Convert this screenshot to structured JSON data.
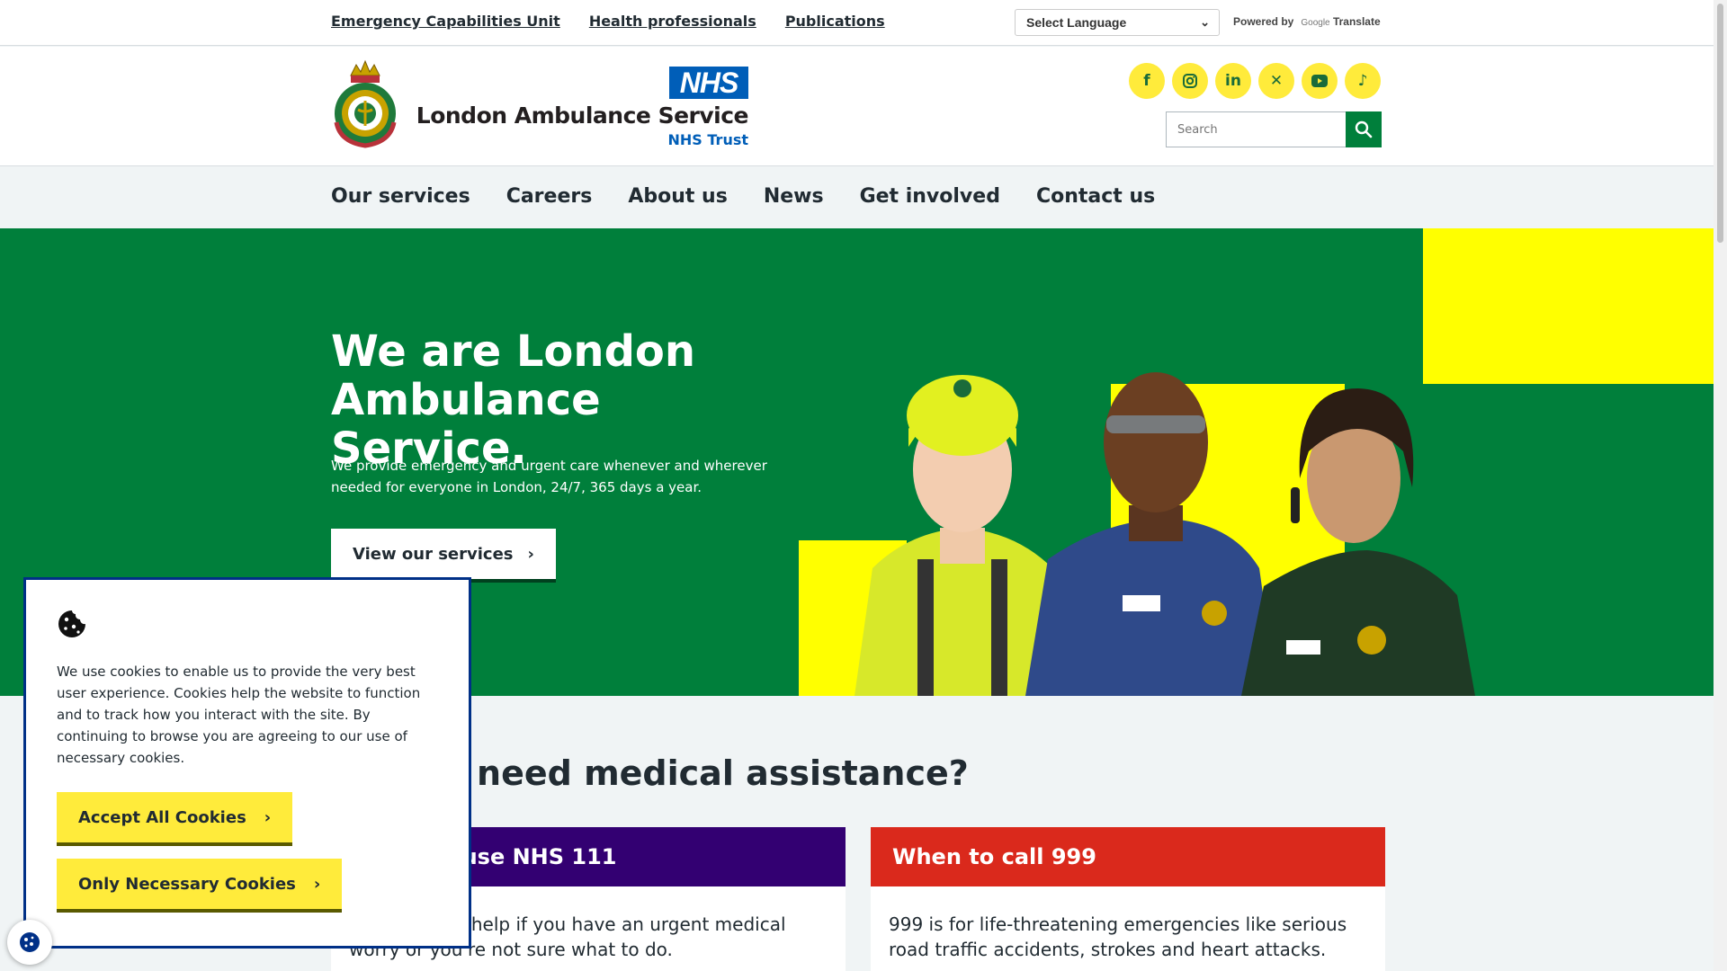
{
  "topbar": {
    "links": [
      "Emergency Capabilities Unit",
      "Health professionals",
      "Publications"
    ],
    "language_select": "Select Language",
    "powered_by": "Powered by",
    "google": "Google",
    "translate": "Translate"
  },
  "header": {
    "nhs_logo": "NHS",
    "org_name": "London Ambulance Service",
    "org_sub": "NHS Trust",
    "socials": [
      "facebook-icon",
      "instagram-icon",
      "linkedin-icon",
      "x-icon",
      "youtube-icon",
      "tiktok-icon"
    ],
    "search_placeholder": "Search"
  },
  "nav": {
    "items": [
      "Our services",
      "Careers",
      "About us",
      "News",
      "Get involved",
      "Contact us"
    ]
  },
  "hero": {
    "title": "We are London Ambulance Service.",
    "description": "We provide emergency and urgent care whenever and wherever needed for everyone in London, 24/7, 365 days a year.",
    "button": "View our services"
  },
  "medical": {
    "title": "Do you need medical assistance?",
    "cards": [
      {
        "title": "When to use NHS 111",
        "body": "NHS 111 can help if you have an urgent medical worry or you're not sure what to do.",
        "color": "#330072"
      },
      {
        "title": "When to call 999",
        "body": "999 is for life-threatening emergencies like serious road traffic accidents, strokes and heart attacks.",
        "color": "#da291c"
      }
    ]
  },
  "cookie": {
    "text": "We use cookies to enable us to provide the very best user experience. Cookies help the website to function and to track how you interact with the site. By continuing to browse you are agreeing to our use of necessary cookies.",
    "accept": "Accept All Cookies",
    "necessary": "Only Necessary Cookies"
  },
  "colors": {
    "nhs_blue": "#005eb8",
    "green": "#007f3b",
    "yellow": "#ffeb3b"
  }
}
